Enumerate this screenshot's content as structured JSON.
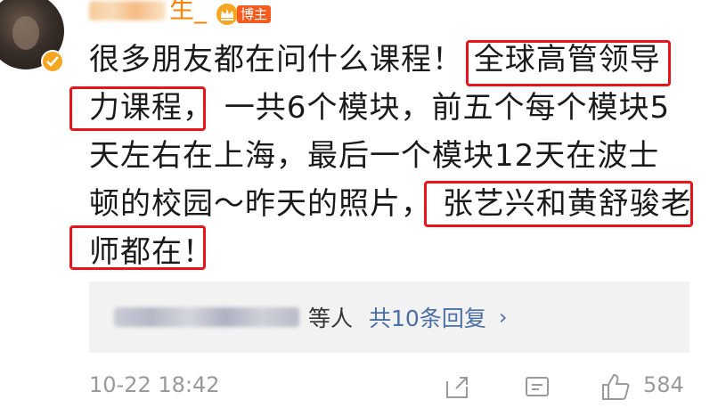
{
  "post": {
    "username_suffix": "生_",
    "badge_label": "博主",
    "content": {
      "line1a": "很多朋友都在问什么课程！",
      "line1b": "全球高管领导",
      "line2a": "力课程，",
      "line2b": "一共6个模块，前五个每个模块5",
      "line3": "天左右在上海，最后一个模块12天在波士",
      "line4a": "顿的校园～昨天的照片，",
      "line4b": "张艺兴和黄舒骏老",
      "line5": "师都在！"
    },
    "replies": {
      "others_label": "等人",
      "count_label": "共10条回复",
      "chevron": "›"
    },
    "footer": {
      "timestamp": "10-22 18:42",
      "like_count": "584"
    }
  },
  "colors": {
    "username": "#ff8200",
    "badge": "#f45b1e",
    "highlight_box": "#e8141c",
    "link": "#4a6fa5"
  },
  "icons": [
    "avatar",
    "verified-icon",
    "crown-icon",
    "share-icon",
    "comment-icon",
    "like-icon"
  ]
}
